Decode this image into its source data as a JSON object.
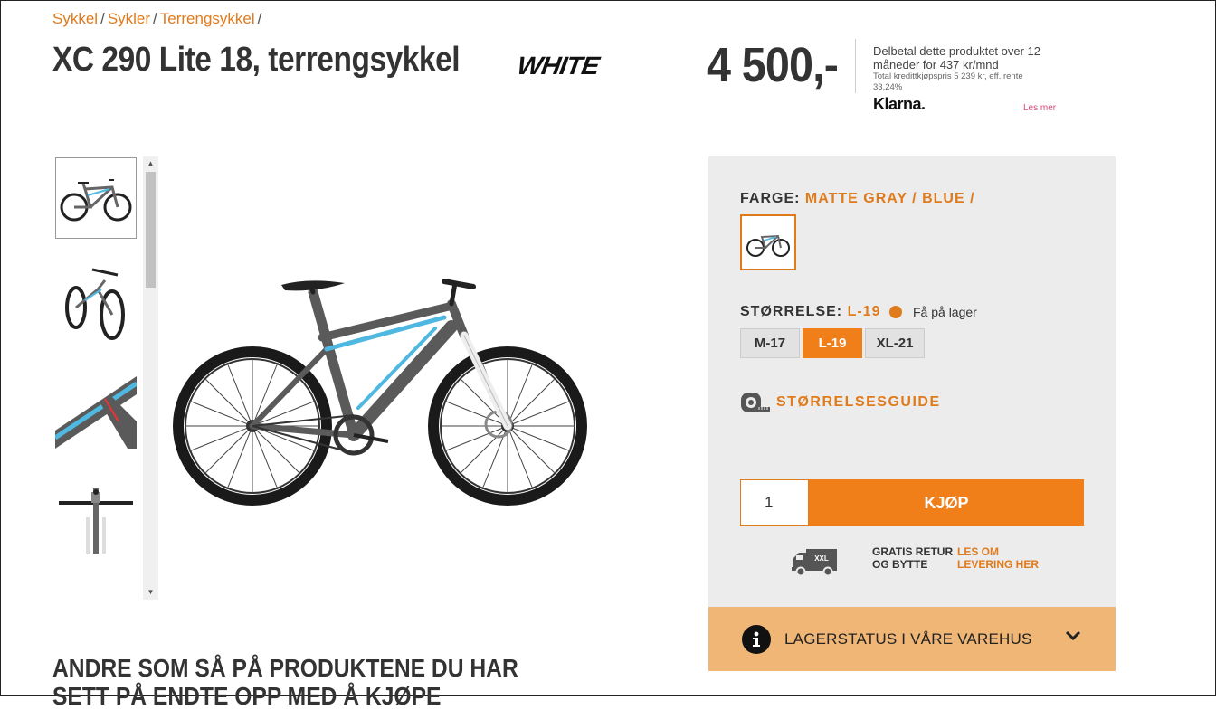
{
  "breadcrumb": {
    "items": [
      "Sykkel",
      "Sykler",
      "Terrengsykkel"
    ],
    "separator": "/"
  },
  "product": {
    "title": "XC 290 Lite 18, terrengsykkel",
    "brand": "WHITE",
    "price": "4 500,-"
  },
  "klarna": {
    "text": "Delbetal dette produktet over 12 måneder for 437 kr/mnd",
    "small": "Total kredittkjøpspris 5 239 kr, eff. rente 33,24%",
    "logo": "Klarna.",
    "more": "Les mer"
  },
  "gallery": {
    "thumb_count": 4,
    "active_thumb": 0
  },
  "options": {
    "color_label": "FARGE:",
    "color_value": "MATTE GRAY / BLUE /",
    "size_label": "STØRRELSE:",
    "size_value": "L-19",
    "stock_text": "Få på lager",
    "sizes": [
      "M-17",
      "L-19",
      "XL-21"
    ],
    "selected_size": "L-19",
    "size_guide": "STØRRELSESGUIDE"
  },
  "purchase": {
    "quantity": "1",
    "buy_label": "KJØP",
    "return_text": "GRATIS RETUR OG BYTTE",
    "truck_label": "XXL",
    "delivery_link": "LES OM LEVERING HER"
  },
  "stock": {
    "label": "LAGERSTATUS I VÅRE VAREHUS"
  },
  "recommend": {
    "heading": "ANDRE SOM SÅ PÅ PRODUKTENE DU HAR SETT PÅ ENDTE OPP MED Å KJØPE"
  },
  "colors": {
    "accent": "#f07f1a",
    "link": "#e07b1c",
    "panel": "#ececec",
    "stock_bar": "#f0b675",
    "frame": "#5a5a5a",
    "frame_accent": "#4fb8e0"
  },
  "icons": [
    "measuring-tape-icon",
    "truck-icon",
    "info-icon",
    "chevron-down-icon"
  ]
}
